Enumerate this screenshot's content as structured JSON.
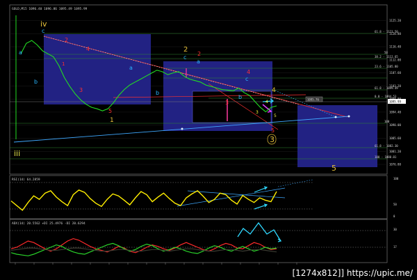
{
  "watermark": "[1274x812]] https://upic.me/",
  "chart_data": [
    {
      "type": "line",
      "panel": "price",
      "header": "GOLD,M15  1096.40  1096.86  1095.49  1095.99",
      "ylim": [
        1074,
        1130
      ],
      "yticks": [
        "1125.20",
        "1120.80",
        "1116.40",
        "1112.00",
        "1107.60",
        "1103.20",
        "1098.80",
        "1094.40",
        "1090.00",
        "1085.60",
        "1081.20",
        "1076.80"
      ],
      "current_price_label": "1095.99",
      "right_price_tag": "1095.76",
      "grid": true,
      "fib_levels": [
        "61.8 - 1121.50",
        "50",
        "38.2 - 1112.65",
        "23.6 - 1105.80",
        "61.8 - 1099.49",
        "0.0 - 1094.53",
        "100",
        "61.8 - 1082.30",
        "100 - 1080.01"
      ],
      "series": [
        {
          "color": "#22dd22",
          "values": [
            1114,
            1117.5,
            1118.5,
            1117,
            1115,
            1114,
            1113,
            1110,
            1106,
            1103,
            1100.5,
            1098.5,
            1097,
            1096,
            1095.5,
            1094.8,
            1095.5,
            1097.5,
            1100,
            1102,
            1103.5,
            1104.5,
            1105.5,
            1106.5,
            1107.5,
            1108.5,
            1108,
            1107,
            1107.6,
            1108,
            1106.5,
            1105.5,
            1105,
            1104.5,
            1103.5,
            1103,
            1102.5,
            1102,
            1101.8,
            1101.5,
            1102.5,
            1101,
            1100,
            1098,
            1096,
            1094.5,
            1096,
            1096.5
          ]
        }
      ],
      "wave_labels": [
        {
          "text": "iv",
          "color": "#e8c23a"
        },
        {
          "text": "c",
          "color": "#29b6ff"
        },
        {
          "text": "a",
          "color": "#29b6ff"
        },
        {
          "text": "b",
          "color": "#29b6ff"
        },
        {
          "text": "iii",
          "color": "#e8e84a"
        },
        {
          "text": "1",
          "color": "#ff3030"
        },
        {
          "text": "2",
          "color": "#ff3030"
        },
        {
          "text": "3",
          "color": "#ff3030"
        },
        {
          "text": "4",
          "color": "#ff3030"
        },
        {
          "text": "5",
          "color": "#ff3030"
        },
        {
          "text": "1",
          "color": "#e8c23a"
        },
        {
          "text": "2",
          "color": "#e8c23a"
        },
        {
          "text": "3",
          "color": "#e8c23a"
        },
        {
          "text": "4",
          "color": "#e8c23a"
        },
        {
          "text": "5",
          "color": "#e8c23a"
        },
        {
          "text": "a",
          "color": "#29b6ff"
        },
        {
          "text": "b",
          "color": "#29b6ff"
        },
        {
          "text": "c",
          "color": "#29b6ff"
        },
        {
          "text": "c",
          "color": "#29b6ff"
        },
        {
          "text": "a",
          "color": "#29b6ff"
        },
        {
          "text": "b",
          "color": "#29b6ff"
        },
        {
          "text": "2",
          "color": "#ff3030"
        },
        {
          "text": "3",
          "color": "#ff3030"
        },
        {
          "text": "4",
          "color": "#ff3030"
        },
        {
          "text": "5",
          "color": "#ff3030"
        },
        {
          "text": "4",
          "color": "#ffff33"
        },
        {
          "text": "3",
          "color": "#ffff33"
        },
        {
          "text": "5",
          "color": "#e8e84a"
        }
      ]
    },
    {
      "type": "line",
      "panel": "rsi",
      "header": "RSI(14) 64.2859",
      "ylim": [
        0,
        100
      ],
      "yticks": [
        "100",
        "50",
        "0"
      ],
      "series": [
        {
          "color": "#ffee00",
          "values": [
            42,
            30,
            18,
            38,
            55,
            46,
            62,
            68,
            52,
            40,
            30,
            58,
            70,
            64,
            48,
            36,
            28,
            46,
            60,
            55,
            44,
            32,
            50,
            66,
            58,
            40,
            52,
            62,
            48,
            36,
            30,
            50,
            60,
            68,
            54,
            38,
            46,
            62,
            58,
            44,
            34,
            56,
            46,
            38,
            50,
            44,
            40,
            66
          ]
        }
      ]
    },
    {
      "type": "line",
      "panel": "adx",
      "header": "ADX(14) 20.5562  +DI 25.4976  -DI 20.6294",
      "ylim": [
        0,
        100
      ],
      "yticks": [
        "30",
        "17"
      ],
      "series": [
        {
          "color": "#ff2a2a",
          "values": [
            30,
            34,
            42,
            50,
            46,
            38,
            30,
            24,
            30,
            40,
            50,
            56,
            52,
            44,
            36,
            30,
            26,
            22,
            28,
            36,
            32,
            24,
            20,
            26,
            34,
            40,
            36,
            30,
            26,
            32,
            40,
            46,
            40,
            34,
            28,
            24,
            30,
            38,
            44,
            40,
            32,
            30,
            38,
            46,
            42,
            34,
            28,
            30
          ]
        },
        {
          "color": "#2ad42a",
          "values": [
            20,
            16,
            14,
            12,
            16,
            22,
            28,
            34,
            40,
            36,
            28,
            22,
            18,
            16,
            22,
            28,
            34,
            40,
            44,
            38,
            30,
            24,
            28,
            36,
            42,
            38,
            30,
            24,
            28,
            34,
            30,
            24,
            20,
            18,
            24,
            32,
            38,
            34,
            28,
            24,
            30,
            36,
            30,
            24,
            28,
            34,
            30,
            32
          ]
        },
        {
          "color": "#3a3a30",
          "values": [
            26,
            28,
            30,
            32,
            32,
            30,
            28,
            26,
            26,
            28,
            30,
            32,
            32,
            30,
            28,
            26,
            24,
            24,
            26,
            28,
            28,
            26,
            24,
            24,
            26,
            28,
            28,
            26,
            24,
            26,
            28,
            30,
            30,
            28,
            26,
            24,
            24,
            26,
            28,
            28,
            26,
            24,
            26,
            28,
            28,
            26,
            24,
            22
          ]
        }
      ]
    }
  ]
}
